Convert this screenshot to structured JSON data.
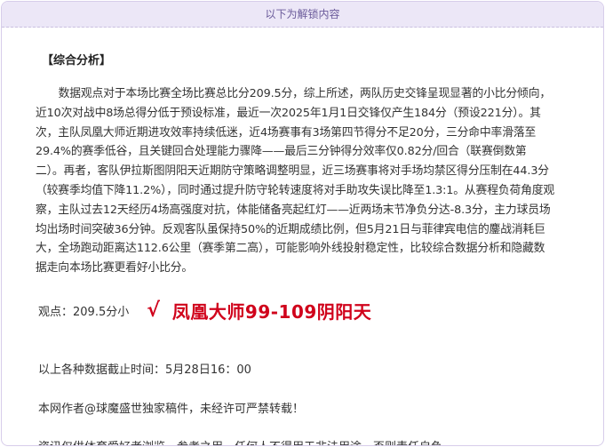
{
  "unlock_banner": "以下为解锁内容",
  "section_title": "【综合分析】",
  "analysis_text": "数据观点对于本场比赛全场比赛总比分209.5分，综上所述，两队历史交锋呈现显著的小比分倾向，\n近10次对战中8场总得分低于预设标准，最近一次2025年1月1日交锋仅产生184分（预设221分）。其\n次，主队凤凰大师近期进攻效率持续低迷，近4场赛事有3场第四节得分不足20分，三分命中率滑落至\n29.4%的赛季低谷，且关键回合处理能力骤降——最后三分钟得分效率仅0.82分/回合（联赛倒数第\n二）。再者，客队伊拉斯图阴阳天近期防守策略调整明显，近三场赛事将对手场均禁区得分压制在44.3分\n（较赛季均值下降11.2%），同时通过提升防守轮转速度将对手助攻失误比降至1.3:1。从赛程负荷角度观\n察，主队过去12天经历4场高强度对抗，体能储备亮起红灯——近两场末节净负分达-8.3分，主力球员场\n均出场时间突破36分钟。反观客队虽保持50%的近期成绩比例，但5月21日与菲律宾电信的鏖战消耗巨\n大，全场跑动距离达112.6公里（赛季第二高），可能影响外线投射稳定性，比较综合数据分析和隐藏数\n据走向本场比赛更看好小比分。",
  "verdict": {
    "label": "观点：209.5分小",
    "check": "√",
    "pick": "凤凰大师99-109阴阳天"
  },
  "data_cutoff": "以上各种数据截止时间：5月28日16：00",
  "author_note": "本网作者@球魔盛世独家稿件，未经许可严禁转载！",
  "disclaimer": "资讯仅供体育爱好者浏览、参考之用。任何人不得用于非法用途，否则责任自负。",
  "colors": {
    "accent_red": "#d0021b",
    "banner_bg": "#ece7f7",
    "banner_text": "#6a5a9a"
  }
}
